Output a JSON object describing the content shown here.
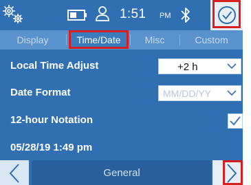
{
  "status_bar": {
    "time": "1:51",
    "ampm": "PM",
    "icons": {
      "settings": "gears-icon",
      "battery": "battery-icon",
      "user": "user-icon",
      "bluetooth": "bluetooth-icon",
      "confirm": "checkmark-circle-icon"
    }
  },
  "tabs": [
    {
      "label": "Display",
      "active": false
    },
    {
      "label": "Time/Date",
      "active": true
    },
    {
      "label": "Misc",
      "active": false
    },
    {
      "label": "Custom",
      "active": false
    }
  ],
  "settings": {
    "local_time_adjust": {
      "label": "Local Time Adjust",
      "value": "+2 h"
    },
    "date_format": {
      "label": "Date Format",
      "value": "MM/DD/YY",
      "disabled": true
    },
    "twelve_hour": {
      "label": "12-hour Notation",
      "checked": true
    }
  },
  "current_datetime": "05/28/19 1:49 pm",
  "bottom_nav": {
    "title": "General",
    "prev_icon": "chevron-left-icon",
    "next_icon": "chevron-right-icon"
  },
  "colors": {
    "background": "#2f6fb2",
    "tab_bar": "#5a92cd",
    "highlight": "#d62020"
  }
}
